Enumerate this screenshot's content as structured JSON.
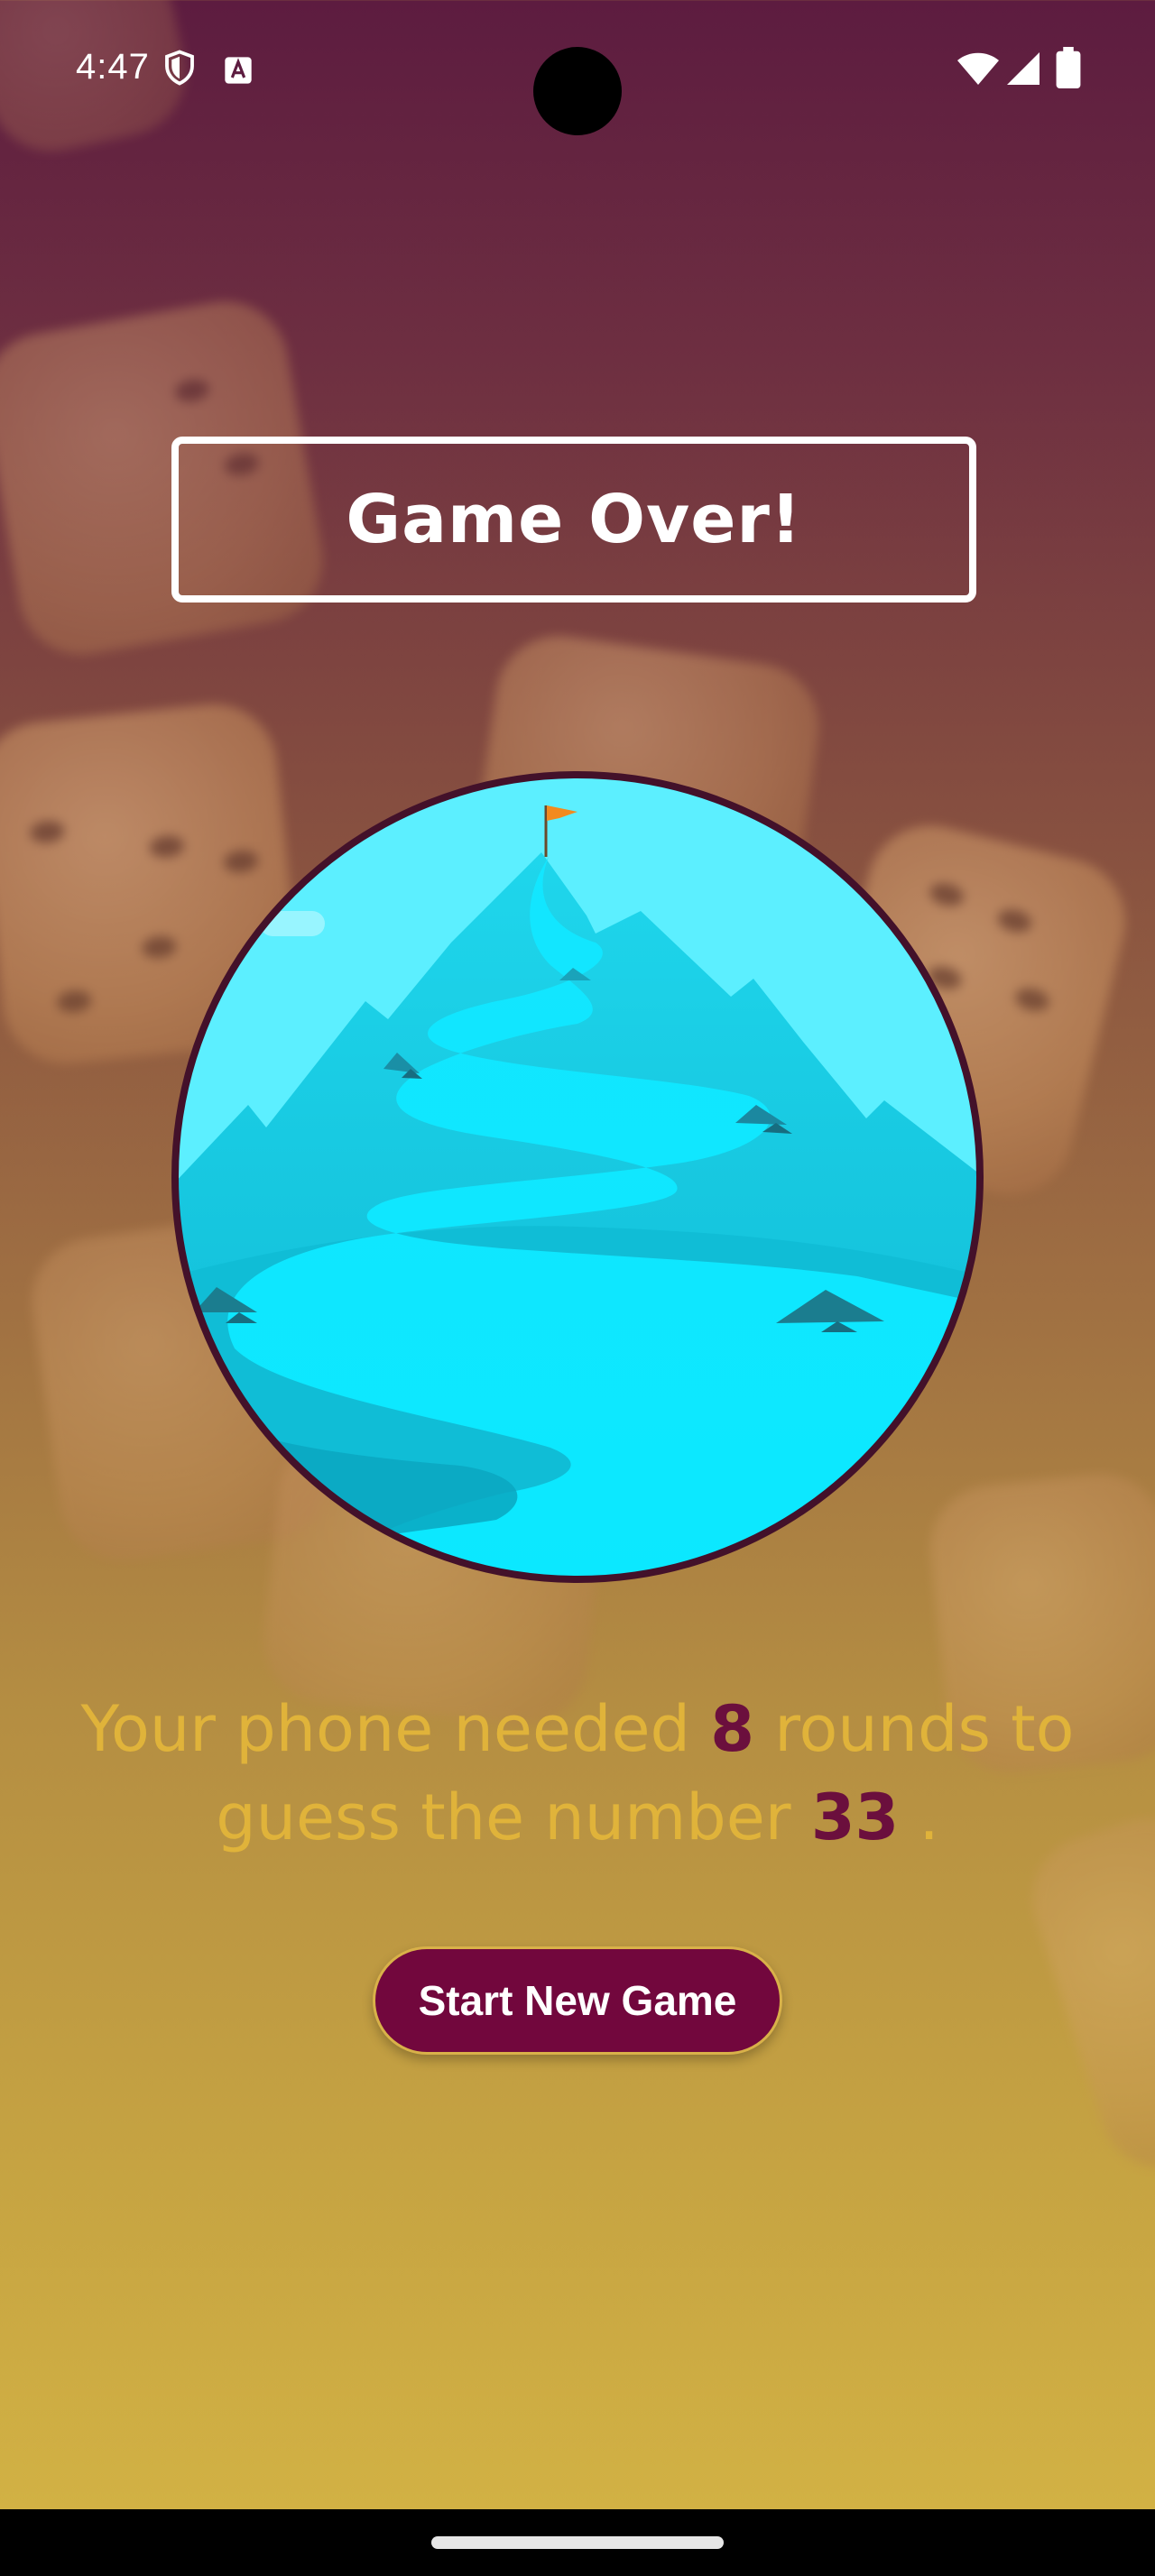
{
  "status_bar": {
    "time": "4:47",
    "left_icons": [
      "shield-icon",
      "keyboard-a-icon"
    ],
    "right_icons": [
      "wifi-icon",
      "signal-icon",
      "battery-icon"
    ]
  },
  "title": "Game Over!",
  "summary": {
    "prefix": "Your phone needed",
    "rounds": "8",
    "middle": "rounds to guess the number",
    "number": "33",
    "suffix": "."
  },
  "buttons": {
    "start_new_game": "Start New Game"
  },
  "colors": {
    "accent": "#72073d",
    "text_gold": "#e0b33a",
    "sky": "#5cefff",
    "mountain": "#13c1d9",
    "river": "#0fe9ff"
  },
  "illustration": {
    "subject": "mountain with flag and winding river"
  }
}
